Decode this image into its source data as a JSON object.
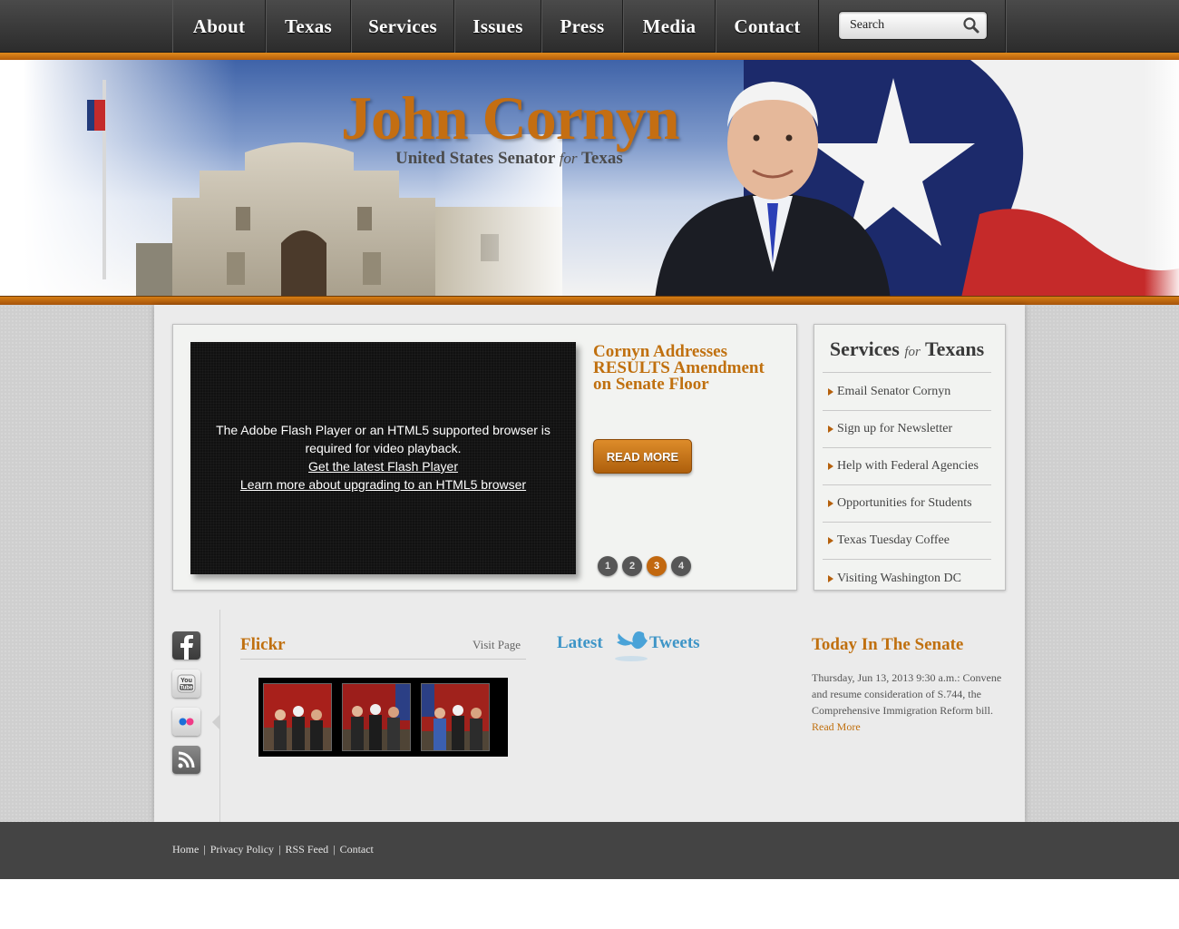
{
  "nav": {
    "items": [
      "About",
      "Texas",
      "Services",
      "Issues",
      "Press",
      "Media",
      "Contact"
    ],
    "search_placeholder": "Search"
  },
  "banner": {
    "title": "John Cornyn",
    "subtitle_pre": "United States Senator",
    "subtitle_for": "for",
    "subtitle_post": "Texas"
  },
  "feature": {
    "video_msg_line1": "The Adobe Flash Player or an HTML5 supported browser is required for video playback.",
    "video_link1": "Get the latest Flash Player",
    "video_link2": "Learn more about upgrading to an HTML5 browser",
    "headline": "Cornyn Addresses RESULTS Amendment on Senate Floor",
    "read_more": "READ MORE",
    "pages": [
      "1",
      "2",
      "3",
      "4"
    ],
    "active_page": 3
  },
  "services": {
    "title_pre": "Services",
    "title_for": "for",
    "title_post": "Texans",
    "items": [
      "Email Senator Cornyn",
      "Sign up for Newsletter",
      "Help with Federal Agencies",
      "Opportunities for Students",
      "Texas Tuesday Coffee",
      "Visiting Washington DC"
    ]
  },
  "social": {
    "icons": [
      "facebook-icon",
      "youtube-icon",
      "flickr-icon",
      "rss-icon"
    ]
  },
  "flickr": {
    "title": "Flickr",
    "visit": "Visit Page"
  },
  "tweets": {
    "latest": "Latest",
    "tweets": "Tweets"
  },
  "senate": {
    "title": "Today In The Senate",
    "text": "Thursday, Jun 13, 2013 9:30 a.m.: Convene and resume consideration of S.744, the Comprehensive Immigration Reform bill.",
    "link": "Read More"
  },
  "footer": {
    "links": [
      "Home",
      "Privacy Policy",
      "RSS Feed",
      "Contact"
    ]
  },
  "colors": {
    "accent": "#c0700f",
    "nav_bg": "#333333",
    "footer_bg": "#444444",
    "twitter": "#3e95c7"
  }
}
